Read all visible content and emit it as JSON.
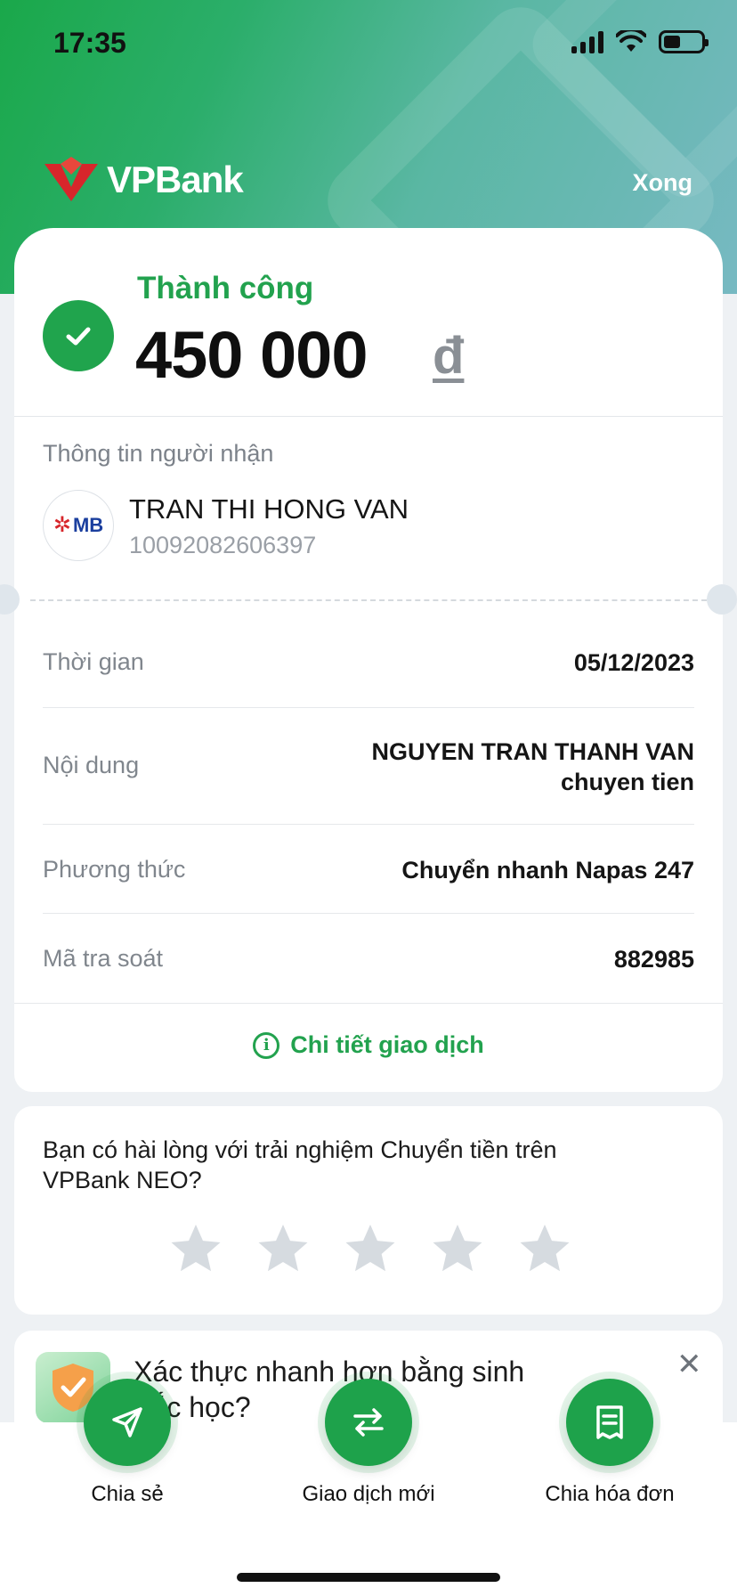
{
  "status_bar": {
    "time": "17:35"
  },
  "header": {
    "brand": "VPBank",
    "done_label": "Xong"
  },
  "summary": {
    "status_label": "Thành công",
    "amount": "450 000",
    "currency": "đ"
  },
  "recipient": {
    "section_title": "Thông tin người nhận",
    "bank_logo_text": "MB",
    "name": "TRAN THI HONG VAN",
    "account": "10092082606397"
  },
  "details": [
    {
      "label": "Thời gian",
      "value": "05/12/2023"
    },
    {
      "label": "Nội dung",
      "value_line1": "NGUYEN TRAN THANH VAN",
      "value_line2": "chuyen tien"
    },
    {
      "label": "Phương thức",
      "value": "Chuyển nhanh Napas 247"
    },
    {
      "label": "Mã tra soát",
      "value": "882985"
    }
  ],
  "detail_link": "Chi tiết giao dịch",
  "rating": {
    "question": "Bạn có hài lòng với trải nghiệm Chuyển tiền trên VPBank NEO?",
    "stars": 5,
    "value": 0
  },
  "promo": {
    "text": "Xác thực nhanh hơn bằng sinh trắc học?"
  },
  "actions": [
    {
      "label": "Chia sẻ",
      "icon": "send-icon"
    },
    {
      "label": "Giao dịch mới",
      "icon": "swap-arrows-icon"
    },
    {
      "label": "Chia hóa đơn",
      "icon": "receipt-icon"
    }
  ],
  "colors": {
    "brand_green": "#20a44d",
    "brand_red": "#d7262b",
    "star_empty": "#d6dbe0"
  }
}
